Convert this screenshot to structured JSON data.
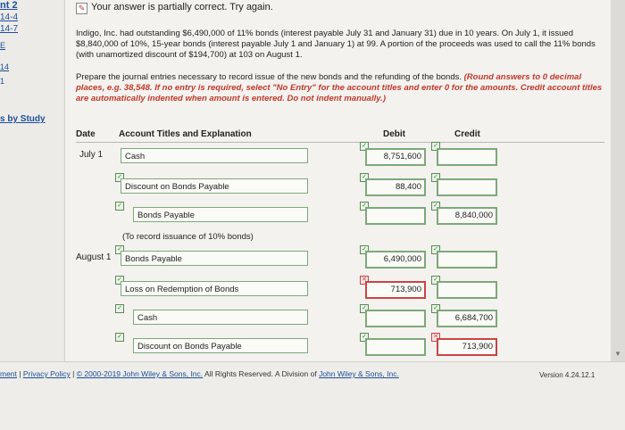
{
  "sidebar": {
    "header": "nt 2",
    "links": [
      "14-4",
      "14-7"
    ],
    "chip1": "E",
    "chip2": "14",
    "chip3": "1",
    "study_link": "s by Study"
  },
  "status": {
    "text": "Your answer is partially correct.  Try again."
  },
  "problem_text": "Indigo, Inc. had outstanding $6,490,000 of 11% bonds (interest payable July 31 and January 31) due in 10 years. On July 1, it issued $8,840,000 of 10%, 15-year bonds (interest payable July 1 and January 1) at 99. A portion of the proceeds was used to call the 11% bonds (with unamortized discount of $194,700) at 103 on August 1.",
  "instructions": {
    "plain": "Prepare the journal entries necessary to record issue of the new bonds and the refunding of the bonds. ",
    "emphasis": "(Round answers to 0 decimal places, e.g. 38,548. If no entry is required, select \"No Entry\" for the account titles and enter 0 for the amounts. Credit account titles are automatically indented when amount is entered. Do not indent manually.)"
  },
  "table": {
    "headers": {
      "date": "Date",
      "account": "Account Titles and Explanation",
      "debit": "Debit",
      "credit": "Credit"
    },
    "rows": [
      {
        "date": "July 1",
        "account": "Cash",
        "debit": "8,751,600",
        "credit": ""
      },
      {
        "date": "",
        "account": "Discount on Bonds Payable",
        "debit": "88,400",
        "credit": ""
      },
      {
        "date": "",
        "account": "Bonds Payable",
        "debit": "",
        "credit": "8,840,000"
      },
      {
        "date": "August 1",
        "account": "Bonds Payable",
        "debit": "6,490,000",
        "credit": ""
      },
      {
        "date": "",
        "account": "Loss on Redemption of Bonds",
        "debit": "713,900",
        "credit": ""
      },
      {
        "date": "",
        "account": "Cash",
        "debit": "",
        "credit": "6,684,700"
      },
      {
        "date": "",
        "account": "Discount on Bonds Payable",
        "debit": "",
        "credit": "713,900"
      }
    ],
    "note": "(To record issuance of 10% bonds)"
  },
  "footer": {
    "link1": "ment",
    "sep1": "|",
    "link2": "Privacy Policy",
    "sep2": "|",
    "copyright_prefix": "© 2000-2019 John Wiley & Sons, Inc.",
    "rights": " All Rights Reserved. A Division of ",
    "link3": "John Wiley & Sons, Inc.",
    "version": "Version 4.24.12.1"
  },
  "colors": {
    "correct": "#7ea87a",
    "wrong": "#c94444",
    "link": "#1e4f9a",
    "emphasis": "#c0392b"
  }
}
